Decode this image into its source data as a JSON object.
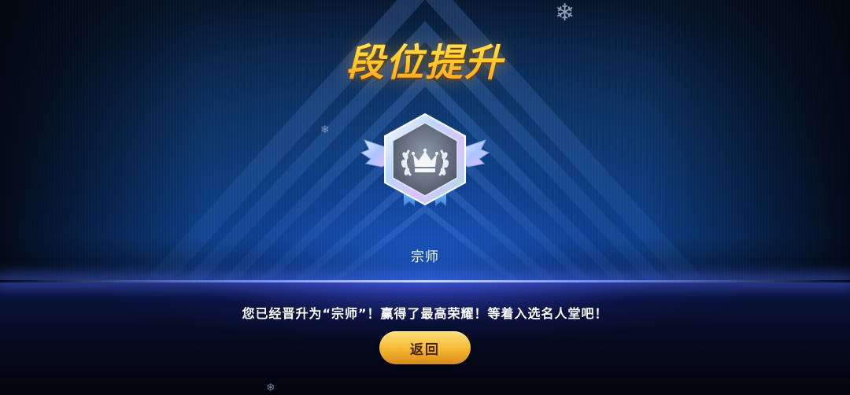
{
  "title": "段位提升",
  "rank": {
    "name": "宗师",
    "icon": "crown-laurel-icon"
  },
  "message": "您已经晋升为“宗师”！赢得了最高荣耀！等着入选名人堂吧！",
  "buttons": {
    "back_label": "返回"
  },
  "decorations": {
    "snowflake_glyph": "❄"
  },
  "colors": {
    "title_gold": "#ffd23a",
    "button_gold": "#f4b733",
    "glow_blue": "#3c6dff"
  }
}
